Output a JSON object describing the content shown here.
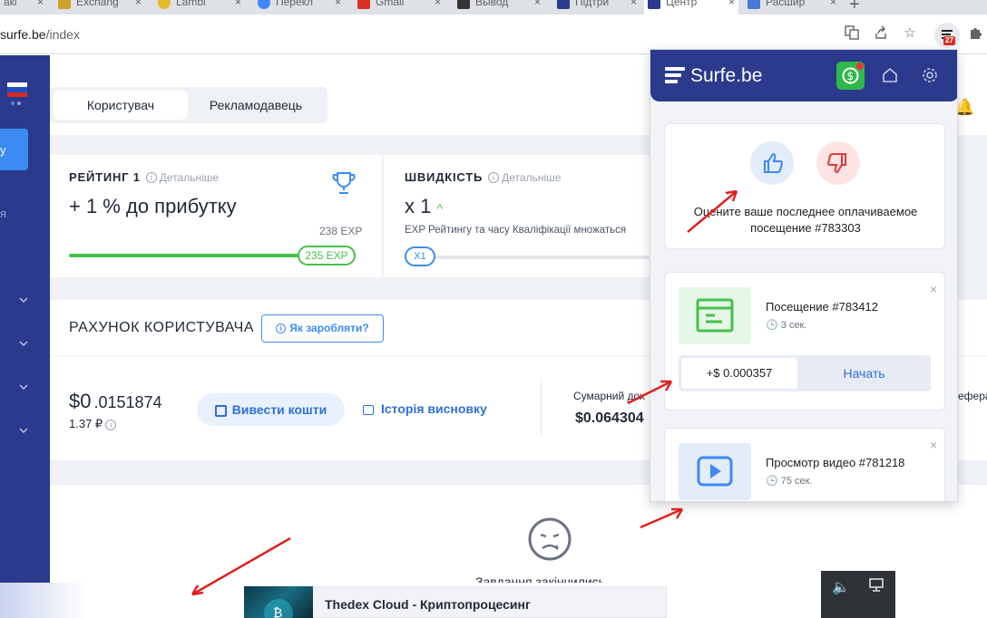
{
  "browser": {
    "tabs": [
      {
        "label": "акі"
      },
      {
        "label": "Exchang"
      },
      {
        "label": "Lambl"
      },
      {
        "label": "Перекл"
      },
      {
        "label": "Gmail"
      },
      {
        "label": "Вывод"
      },
      {
        "label": "Підтри"
      },
      {
        "label": "Центр",
        "active": true
      },
      {
        "label": "Расшир"
      }
    ],
    "url_host": "surfe.be",
    "url_path": "/index",
    "extension_badge": "27"
  },
  "page": {
    "side_button": "у",
    "side_text": "я",
    "seg_user": "Користувач",
    "seg_advertiser": "Рекламодавець",
    "rating": {
      "title": "РЕЙТИНГ 1",
      "details": "Детальніше",
      "bonus": "+ 1 % до прибутку",
      "exp_total": "238 EXP",
      "exp_current": "235 EXP",
      "progress_fraction": 0.987
    },
    "speed": {
      "title": "ШВИДКІСТЬ",
      "details": "Детальніше",
      "value": "x 1",
      "desc": "EXP Рейтингу та часу Кваліфікації множаться",
      "pill": "X1"
    },
    "account": {
      "title": "РАХУНОК КОРИСТУВАЧА",
      "how_to_earn": "Як заробляти?",
      "balance_main": "$0",
      "balance_frac": ".0151874",
      "balance_sub": "1.37 ₽",
      "withdraw": "Вивести кошти",
      "history": "Історія висновку",
      "total_label": "Сумарний дох",
      "total_value": "$0.064304",
      "ref_label": "ефера"
    },
    "tasks_done": "Завдання закінчились"
  },
  "ad": {
    "title": "Thedex Cloud - Криптопроцесинг"
  },
  "popup": {
    "logo": "Surfe.be",
    "rate_text_line1": "Оцените ваше последнее оплачиваемое",
    "rate_text_line2": "посещение #783303",
    "visits": [
      {
        "title": "Посещение #783412",
        "time": "3 сек.",
        "reward": "+$ 0.000357",
        "action": "Начать"
      },
      {
        "title": "Просмотр видео #781218",
        "time": "75 сек."
      }
    ]
  },
  "colors": {
    "brand": "#2b3a8c",
    "accent": "#3d8bf2",
    "success": "#46c04b",
    "danger": "#e53935"
  }
}
